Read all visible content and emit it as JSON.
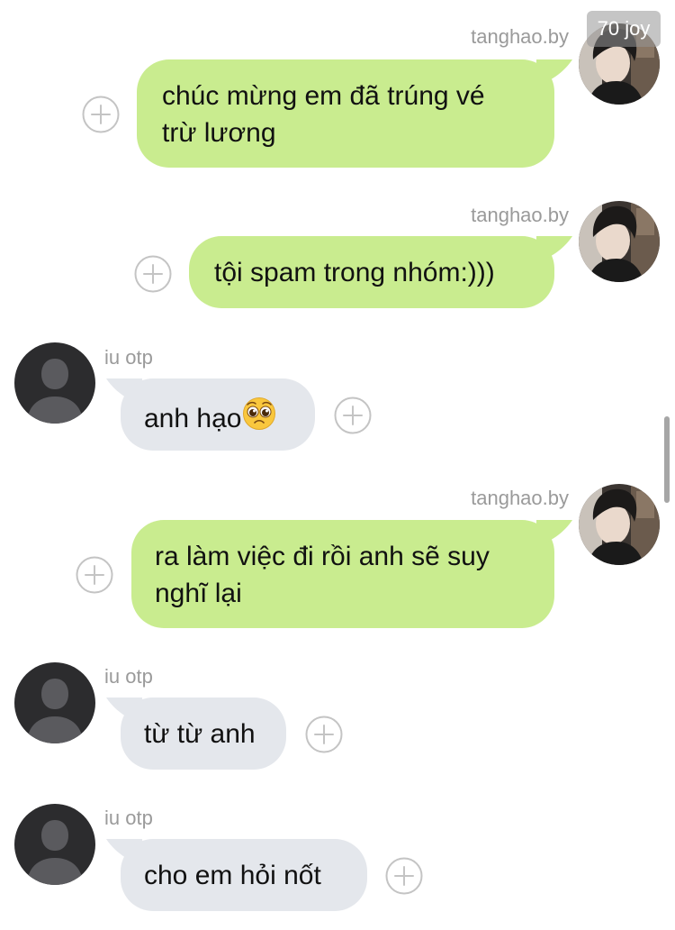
{
  "watermark": "70 joy",
  "messages": [
    {
      "sender": "tanghao.by",
      "lines": [
        "chúc mừng em đã trúng vé",
        "trừ lương"
      ]
    },
    {
      "sender": "tanghao.by",
      "lines": [
        "tội spam trong nhóm:)))"
      ]
    },
    {
      "sender": "iu otp",
      "lines": [
        "anh hạo"
      ],
      "emoji": "pleading-face"
    },
    {
      "sender": "tanghao.by",
      "lines": [
        "ra làm việc đi rồi anh sẽ suy",
        "nghĩ lại"
      ]
    },
    {
      "sender": "iu otp",
      "lines": [
        "từ từ anh"
      ]
    },
    {
      "sender": "iu otp",
      "lines": [
        "cho em hỏi nốt"
      ]
    }
  ],
  "colors": {
    "outgoing_bubble": "#c9ec8f",
    "incoming_bubble": "#e4e7ec",
    "sender_text": "#9a9a9a",
    "add_reaction_icon": "#c4c4c4"
  }
}
